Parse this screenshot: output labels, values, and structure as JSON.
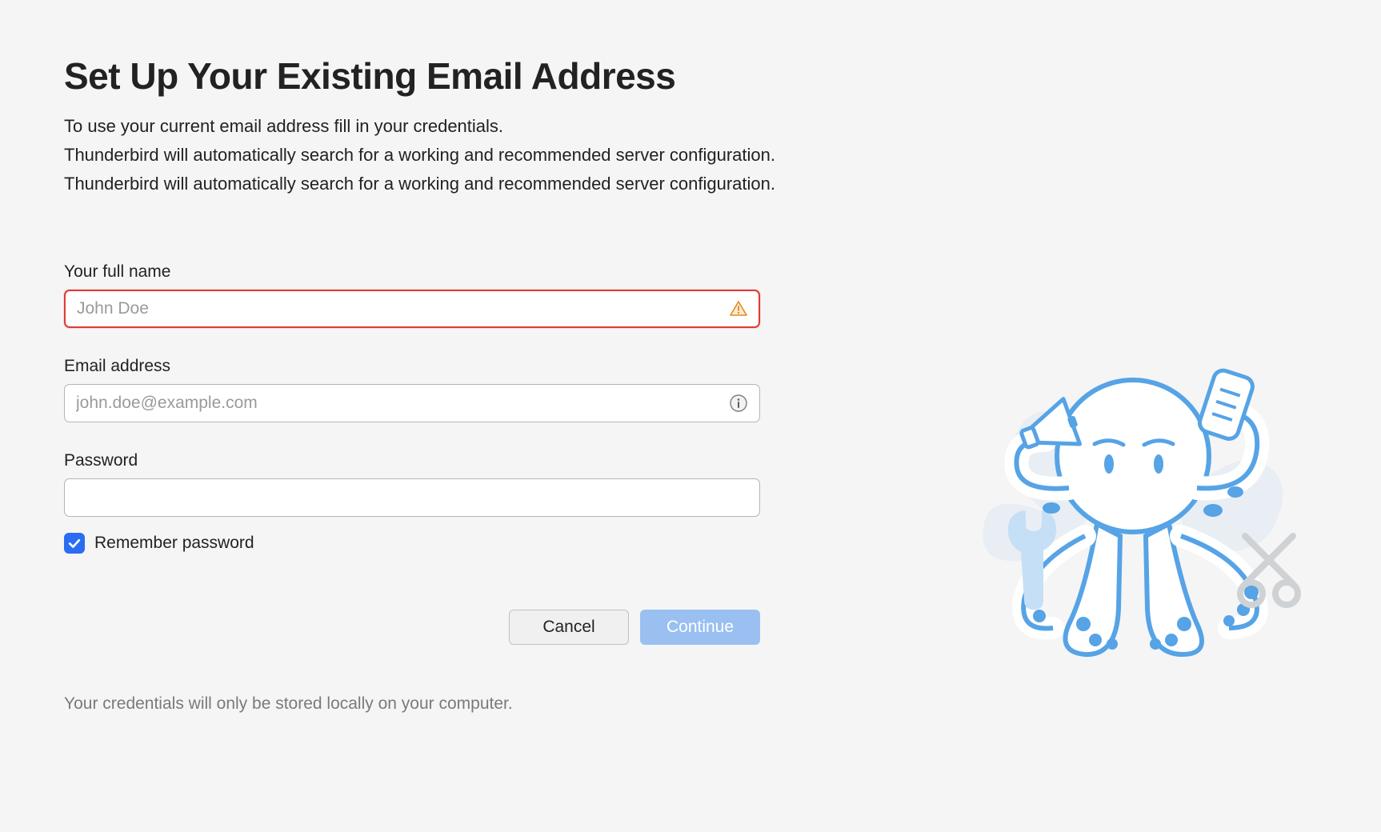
{
  "title": "Set Up Your Existing Email Address",
  "intro_lines": [
    "To use your current email address fill in your credentials.",
    "Thunderbird will automatically search for a working and recommended server configuration.",
    "Thunderbird will automatically search for a working and recommended server configuration."
  ],
  "fields": {
    "full_name": {
      "label": "Your full name",
      "placeholder": "John Doe",
      "value": "",
      "error": true
    },
    "email": {
      "label": "Email address",
      "placeholder": "john.doe@example.com",
      "value": ""
    },
    "password": {
      "label": "Password",
      "placeholder": "",
      "value": ""
    }
  },
  "remember": {
    "label": "Remember password",
    "checked": true
  },
  "buttons": {
    "cancel": "Cancel",
    "continue": "Continue"
  },
  "footer_note": "Your credentials will only be stored locally on your computer.",
  "colors": {
    "error": "#e03a36",
    "primary_disabled": "#99c0f1",
    "checkbox": "#2a6df4"
  }
}
